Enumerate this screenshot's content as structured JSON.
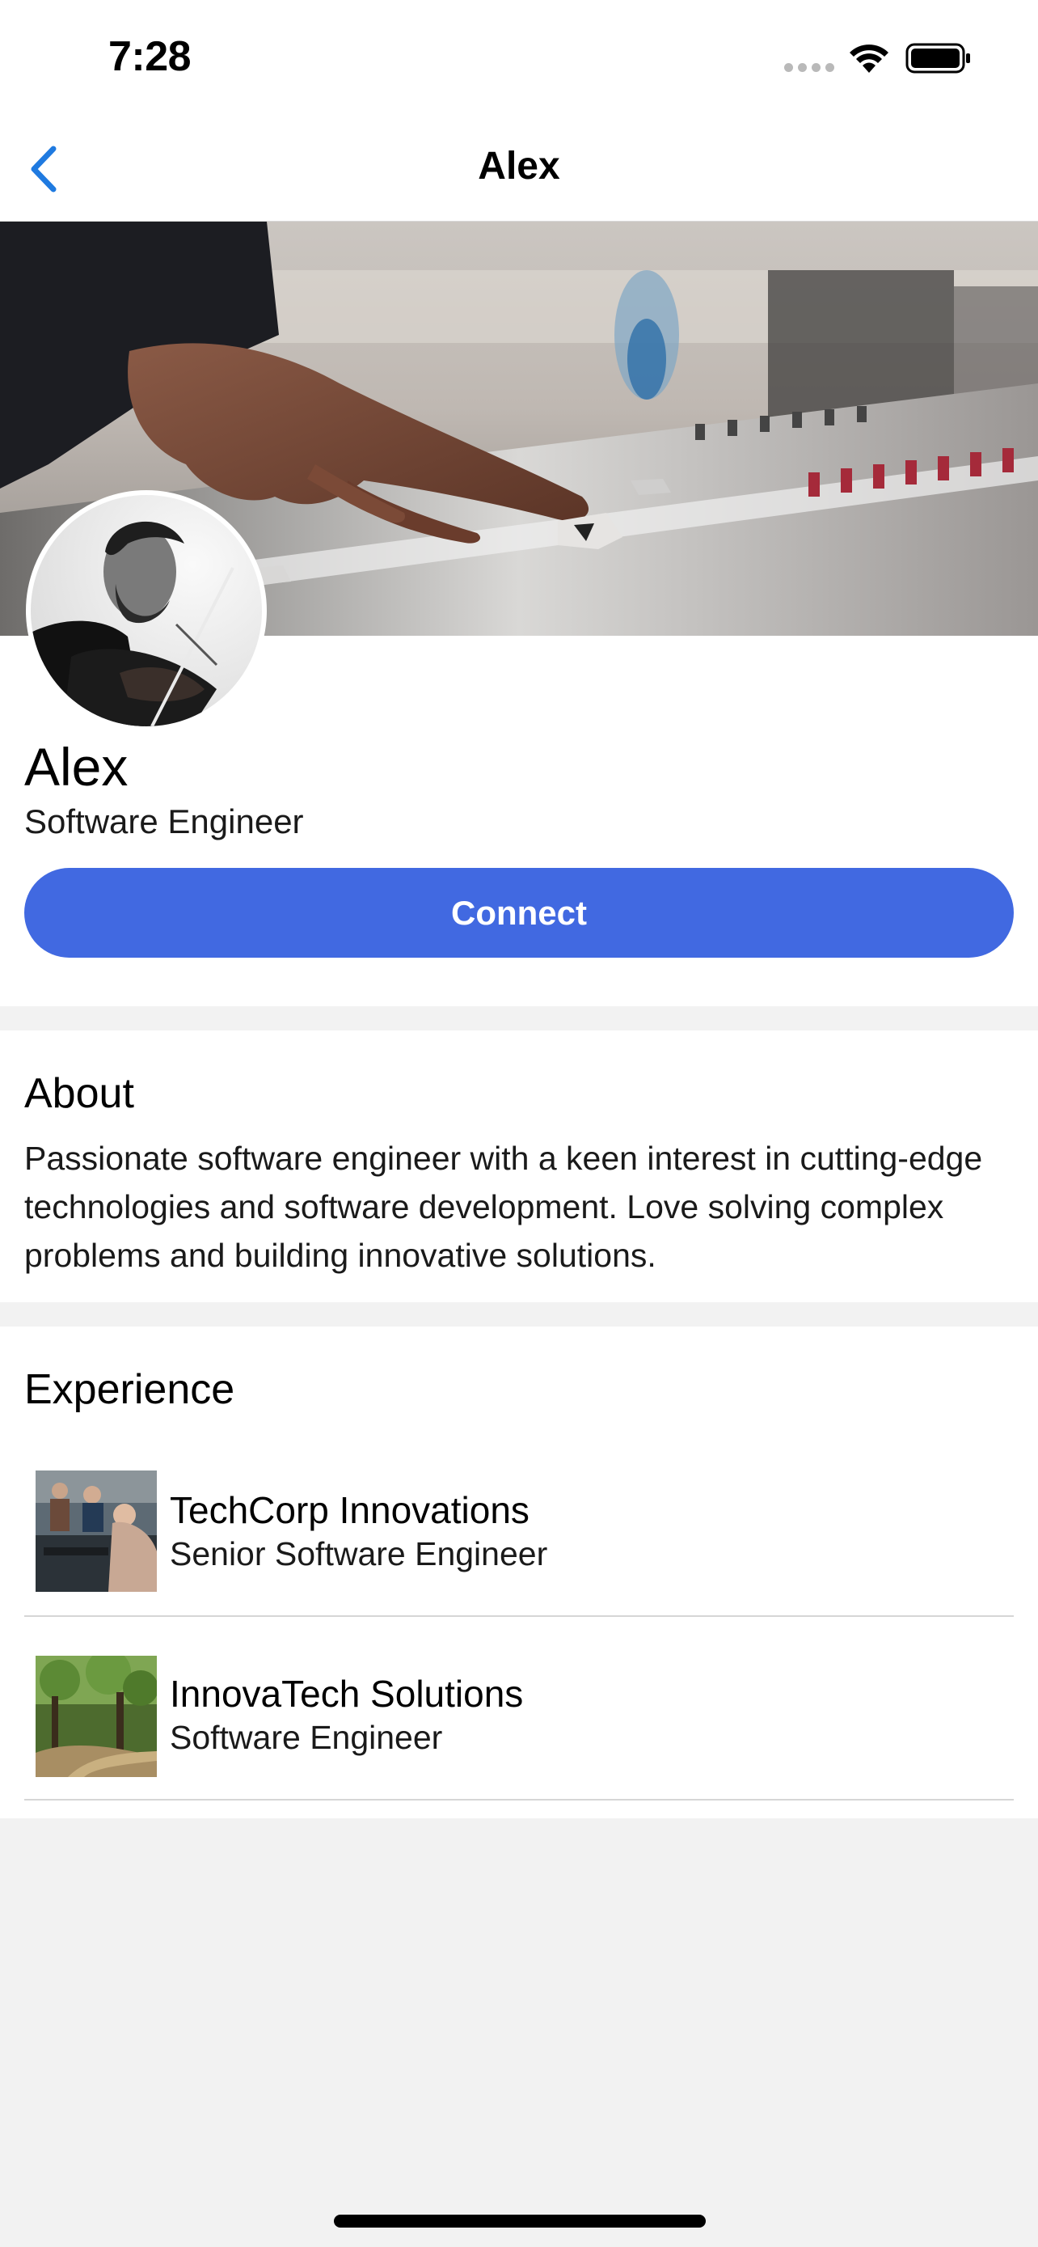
{
  "status_bar": {
    "time": "7:28"
  },
  "nav": {
    "title": "Alex"
  },
  "profile": {
    "name": "Alex",
    "role": "Software Engineer",
    "connect_label": "Connect"
  },
  "about": {
    "title": "About",
    "text": "Passionate software engineer with a keen interest in cutting-edge technologies and software development. Love solving complex problems and building innovative solutions."
  },
  "experience": {
    "title": "Experience",
    "items": [
      {
        "company": "TechCorp Innovations",
        "position": "Senior Software Engineer"
      },
      {
        "company": "InnovaTech Solutions",
        "position": "Software Engineer"
      }
    ]
  },
  "colors": {
    "accent": "#4169e1",
    "nav_back": "#1f7ae0",
    "background": "#f2f2f2"
  }
}
